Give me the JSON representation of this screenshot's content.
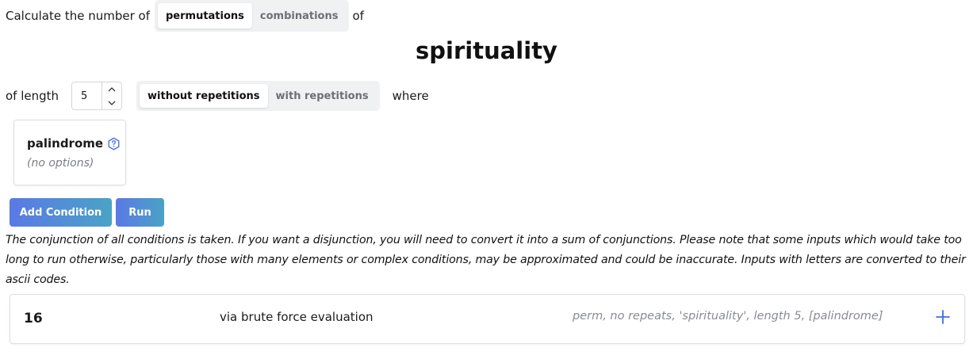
{
  "header": {
    "prefix": "Calculate the number of",
    "type_options": [
      "permutations",
      "combinations"
    ],
    "type_selected": "permutations",
    "suffix": "of"
  },
  "word": "spirituality",
  "length_row": {
    "label": "of length",
    "value": "5",
    "repetition_options": [
      "without repetitions",
      "with repetitions"
    ],
    "repetition_selected": "without repetitions",
    "where": "where"
  },
  "condition": {
    "name": "palindrome",
    "options_text": "(no options)",
    "help_icon": "question-hexagon-icon"
  },
  "buttons": {
    "add_condition": "Add Condition",
    "run": "Run"
  },
  "note": "The conjunction of all conditions is taken. If you want a disjunction, you will need to convert it into a sum of conjunctions. Please note that some inputs which would take too long to run otherwise, particularly those with many elements or complex conditions, may be approximated and could be inaccurate. Inputs with letters are converted to their ascii codes.",
  "result": {
    "count": "16",
    "method": "via brute force evaluation",
    "description": "perm, no repeats, 'spirituality', length 5, [palindrome]",
    "expand_icon": "plus-icon"
  },
  "colors": {
    "accent_start": "#5a79e6",
    "accent_end": "#4aa3c5",
    "segment_bg": "#f0f1f3",
    "help_icon": "#4a6fe0",
    "plus_icon": "#3b6fe0"
  }
}
